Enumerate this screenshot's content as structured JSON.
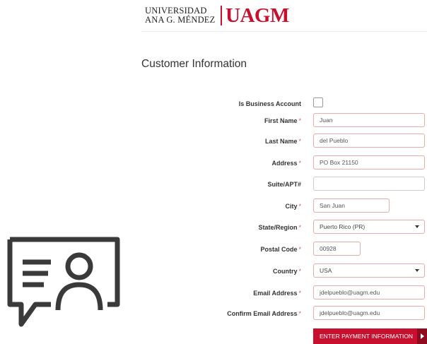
{
  "brand": {
    "line1": "UNIVERSIDAD",
    "line2": "ANA G. MÉNDEZ",
    "mark": "UAGM"
  },
  "section_title": "Customer Information",
  "required_marker": "*",
  "fields": {
    "business": {
      "label": "Is Business Account",
      "checked": false
    },
    "first_name": {
      "label": "First Name",
      "value": "Juan"
    },
    "last_name": {
      "label": "Last Name",
      "value": "del Pueblo"
    },
    "address": {
      "label": "Address",
      "value": "PO Box 21150"
    },
    "suite": {
      "label": "Suite/APT#",
      "value": ""
    },
    "city": {
      "label": "City",
      "value": "San Juan"
    },
    "state": {
      "label": "State/Region",
      "value": "Puerto Rico (PR)"
    },
    "postal": {
      "label": "Postal Code",
      "value": "00928"
    },
    "country": {
      "label": "Country",
      "value": "USA"
    },
    "email": {
      "label": "Email Address",
      "value": "jdelpueblo@uagm.edu"
    },
    "confirm_email": {
      "label": "Confirm Email Address",
      "value": "jdelpueblo@uagm.edu"
    }
  },
  "submit_label": "ENTER PAYMENT INFORMATION",
  "colors": {
    "brand_red": "#c8102e",
    "field_border": "#e8aaaa",
    "required": "#e05a5a"
  },
  "icons": {
    "contact": "customer-contact-icon",
    "submit_arrow": "arrow-right-icon",
    "dropdown": "chevron-down-icon"
  }
}
